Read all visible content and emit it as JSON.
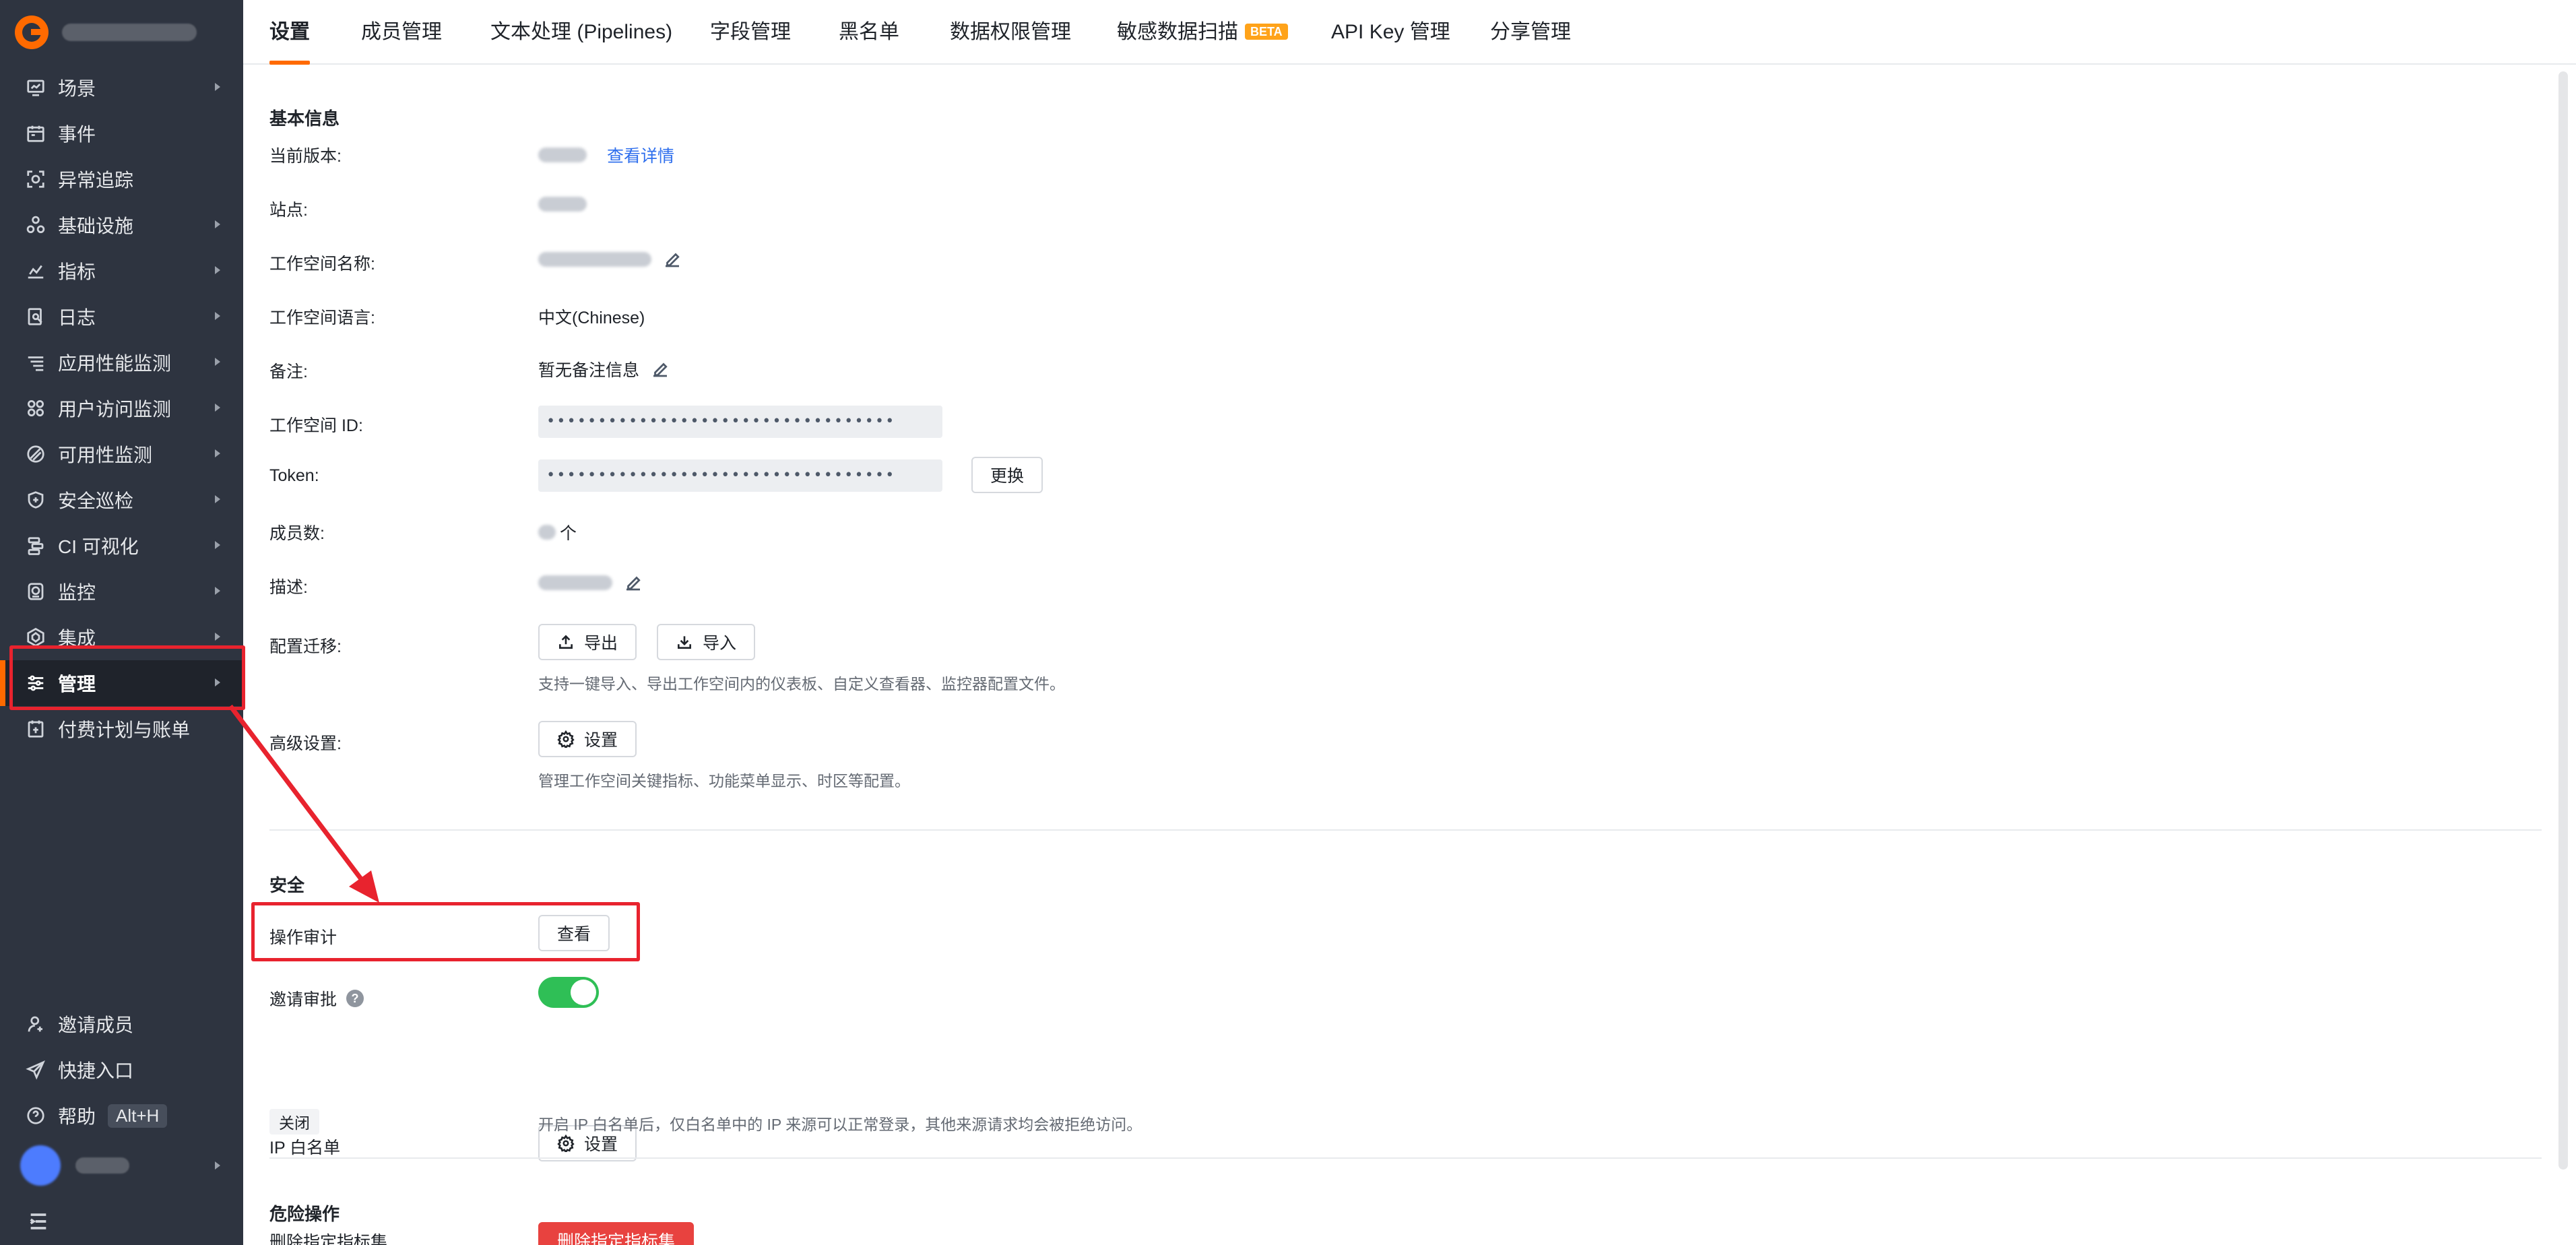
{
  "sidebar": {
    "items": [
      {
        "label": "场景",
        "icon": "scene-icon",
        "arrow": true
      },
      {
        "label": "事件",
        "icon": "event-icon",
        "arrow": false
      },
      {
        "label": "异常追踪",
        "icon": "exception-tracking-icon",
        "arrow": false
      },
      {
        "label": "基础设施",
        "icon": "infrastructure-icon",
        "arrow": true
      },
      {
        "label": "指标",
        "icon": "metrics-icon",
        "arrow": true
      },
      {
        "label": "日志",
        "icon": "log-icon",
        "arrow": true
      },
      {
        "label": "应用性能监测",
        "icon": "apm-icon",
        "arrow": true
      },
      {
        "label": "用户访问监测",
        "icon": "rum-icon",
        "arrow": true
      },
      {
        "label": "可用性监测",
        "icon": "availability-icon",
        "arrow": true
      },
      {
        "label": "安全巡检",
        "icon": "security-check-icon",
        "arrow": true
      },
      {
        "label": "CI 可视化",
        "icon": "ci-icon",
        "arrow": true
      },
      {
        "label": "监控",
        "icon": "monitor-icon",
        "arrow": true
      },
      {
        "label": "集成",
        "icon": "integration-icon",
        "arrow": true
      },
      {
        "label": "管理",
        "icon": "management-icon",
        "arrow": true,
        "active": true
      },
      {
        "label": "付费计划与账单",
        "icon": "billing-icon",
        "arrow": false
      }
    ],
    "bottom": {
      "invite": "邀请成员",
      "shortcut": "快捷入口",
      "help": "帮助",
      "help_key": "Alt+H"
    }
  },
  "tabs": [
    {
      "label": "设置",
      "active": true
    },
    {
      "label": "成员管理"
    },
    {
      "label": "文本处理 (Pipelines)"
    },
    {
      "label": "字段管理"
    },
    {
      "label": "黑名单"
    },
    {
      "label": "数据权限管理"
    },
    {
      "label": "敏感数据扫描",
      "badge": "BETA"
    },
    {
      "label": "API Key 管理"
    },
    {
      "label": "分享管理"
    }
  ],
  "basic": {
    "title": "基本信息",
    "version_label": "当前版本:",
    "version_link": "查看详情",
    "site_label": "站点:",
    "ws_name_label": "工作空间名称:",
    "ws_lang_label": "工作空间语言:",
    "ws_lang_value": "中文(Chinese)",
    "remark_label": "备注:",
    "remark_value": "暂无备注信息",
    "ws_id_label": "工作空间 ID:",
    "ws_id_value": "••••••••••••••••••••••••••••••••••",
    "token_label": "Token:",
    "token_value": "••••••••••••••••••••••••••••••••••",
    "token_change": "更换",
    "members_label": "成员数:",
    "members_unit": "个",
    "desc_label": "描述:",
    "migrate_label": "配置迁移:",
    "export_btn": "导出",
    "import_btn": "导入",
    "migrate_hint": "支持一键导入、导出工作空间内的仪表板、自定义查看器、监控器配置文件。",
    "advanced_label": "高级设置:",
    "advanced_btn": "设置",
    "advanced_hint": "管理工作空间关键指标、功能菜单显示、时区等配置。"
  },
  "security": {
    "title": "安全",
    "audit_label": "操作审计",
    "audit_btn": "查看",
    "invite_approval_label": "邀请审批",
    "invite_approval_on": true,
    "ip_label": "IP 白名单",
    "ip_btn": "设置",
    "ip_status": "关闭",
    "ip_hint": "开启 IP 白名单后，仅白名单中的 IP 来源可以正常登录，其他来源请求均会被拒绝访问。"
  },
  "danger": {
    "title": "危险操作",
    "delete_label": "删除指定指标集",
    "delete_btn": "删除指定指标集"
  },
  "colors": {
    "accent": "#ff6a00",
    "sidebar_bg": "#2e3440",
    "annotation": "#e8232e",
    "toggle_on": "#2fbf56",
    "link": "#2f6fed",
    "danger": "#e8423f"
  }
}
